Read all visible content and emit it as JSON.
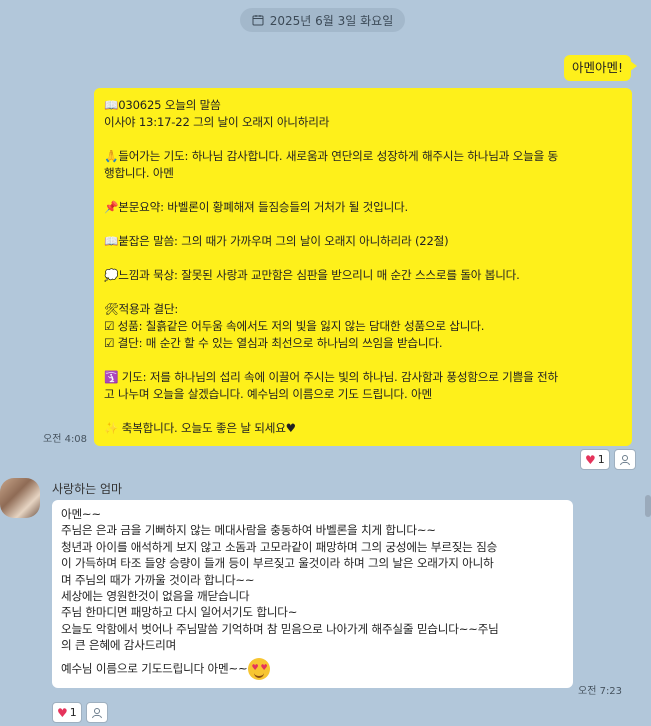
{
  "date_divider": "2025년 6월 3일 화요일",
  "my_short_message": "아멘아멘!",
  "my_devotion": {
    "lines": [
      "📖030625 오늘의 말씀",
      "이사야 13:17-22 그의 날이 오래지 아니하리라",
      "",
      "🙏들어가는 기도: 하나님 감사합니다. 새로움과 연단의로 성장하게 해주시는 하나님과 오늘을 동",
      "행합니다. 아멘",
      "",
      "📌본문요약: 바벨론이 황폐해져 들짐승들의 거처가 될 것입니다.",
      "",
      "📖붙잡은 말씀: 그의 때가 가까우며 그의 날이 오래지 아니하리라 (22절)",
      "",
      "💭느낌과 묵상: 잘못된 사랑과 교만함은 심판을 받으리니 매 순간 스스로를 돌아 봅니다.",
      "",
      "🛠적용과 결단:",
      "☑ 성품: 칠흙같은 어두움 속에서도 저의 빛을 잃지 않는 담대한 성품으로 삽니다.",
      "☑ 결단: 매 순간 할 수 있는 열심과 최선으로 하나님의 쓰임을 받습니다.",
      "",
      "🛐 기도: 저를 하나님의 섭리 속에 이끌어 주시는 빛의 하나님. 감사함과 풍성함으로 기쁨을 전하",
      "고 나누며 오늘을 살겠습니다. 예수님의 이름으로 기도 드립니다. 아멘",
      "",
      "✨ 축복합니다. 오늘도 좋은 날 되세요♥"
    ],
    "time": "오전 4:08",
    "reaction_count": "1"
  },
  "other_message": {
    "sender": "사랑하는 엄마",
    "lines": [
      "아멘~~",
      "주님은 은과 금을 기뻐하지 않는 메대사람을 충동하여 바벨론을 치게 합니다~~",
      "청년과 아이를 애석하게 보지 않고 소돔과 고모라같이 패망하며 그의 궁성에는 부르짖는 짐승",
      "이 가득하며 타조 들양 승량이 들개 등이 부르짖고 울것이라 하며 그의 날은 오래가지 아니하",
      "며 주님의 때가 가까울 것이라 합니다~~",
      "세상에는 영원한것이 없음을 깨닫습니다",
      "주님 한마디면 패망하고 다시 일어서기도 합니다~",
      "오늘도 악함에서 벗어나 주님말씀 기억하며 참 믿음으로 나아가게 해주실줄 믿습니다~~주님",
      "의 큰 은혜에 감사드리며"
    ],
    "last_line": "예수님 이름으로 기도드립니다 아멘~~",
    "emoji": "heart-eyes-emoji",
    "time": "오전 7:23",
    "reaction_count": "1"
  },
  "colors": {
    "background": "#b2c7da",
    "my_bubble": "#fef01b",
    "other_bubble": "#ffffff",
    "heart": "#e5335b"
  }
}
